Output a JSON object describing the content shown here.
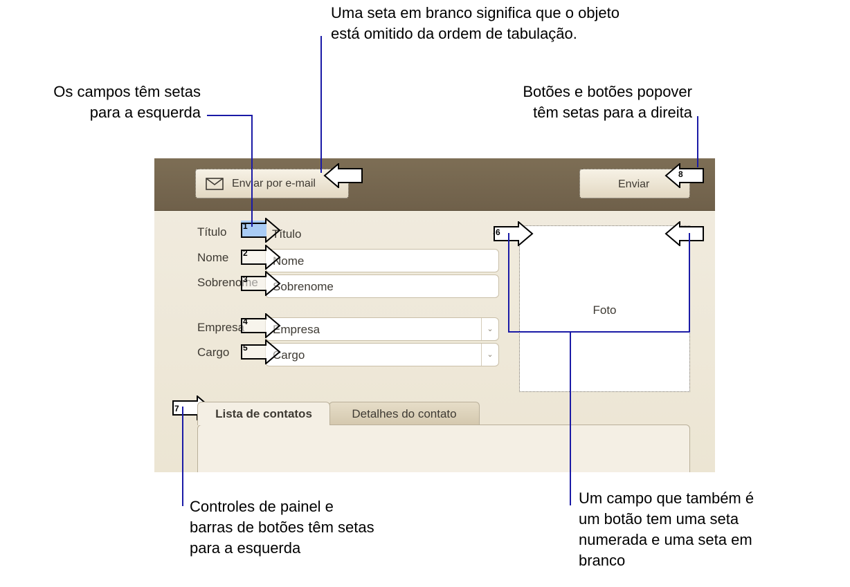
{
  "callouts": {
    "top": "Uma seta em branco significa que o objeto\nestá omitido da ordem de tabulação.",
    "left": "Os campos têm setas\npara a esquerda",
    "right": "Botões e botões popover\ntêm setas para a direita",
    "bottom_left": "Controles de painel e\nbarras de botões têm setas\npara a esquerda",
    "bottom_right": "Um campo que também é\num botão tem uma seta\nnumerada e uma seta em\nbranco"
  },
  "toolbar": {
    "email_label": "Enviar por e-mail",
    "send_label": "Enviar"
  },
  "form": {
    "titulo": {
      "label": "Título",
      "value": "Título"
    },
    "nome": {
      "label": "Nome",
      "value": "Nome"
    },
    "sobrenome": {
      "label": "Sobrenome",
      "value": "Sobrenome"
    },
    "empresa": {
      "label": "Empresa",
      "value": "Empresa"
    },
    "cargo": {
      "label": "Cargo",
      "value": "Cargo"
    }
  },
  "photo_label": "Foto",
  "tabs": [
    {
      "label": "Lista de contatos"
    },
    {
      "label": "Detalhes do contato"
    }
  ],
  "tab_order": [
    "1",
    "2",
    "3",
    "4",
    "5",
    "6",
    "7",
    "8"
  ],
  "colors": {
    "toolbar": "#76674f",
    "panel": "#efe9dc",
    "leader_line": "#1a1aa6",
    "highlight": "#a9ccf5"
  }
}
